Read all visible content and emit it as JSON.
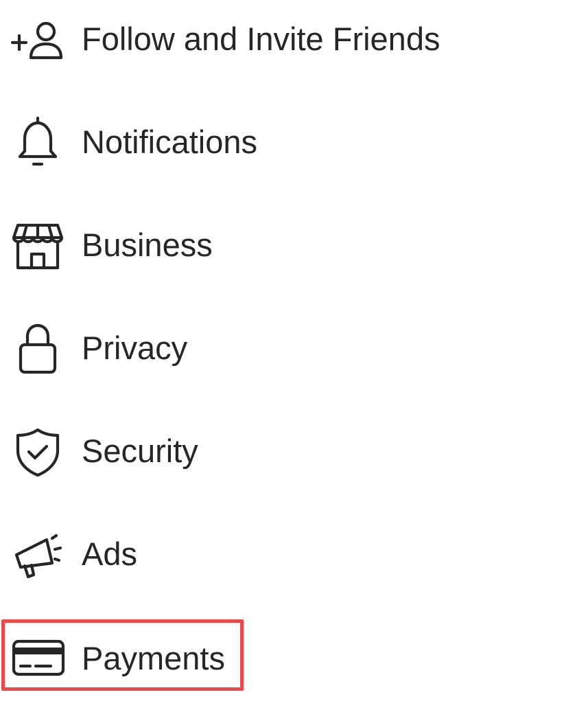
{
  "menu": {
    "items": [
      {
        "label": "Follow and Invite Friends",
        "icon": "add-friend-icon"
      },
      {
        "label": "Notifications",
        "icon": "bell-icon"
      },
      {
        "label": "Business",
        "icon": "storefront-icon"
      },
      {
        "label": "Privacy",
        "icon": "lock-icon"
      },
      {
        "label": "Security",
        "icon": "shield-check-icon"
      },
      {
        "label": "Ads",
        "icon": "megaphone-icon"
      },
      {
        "label": "Payments",
        "icon": "credit-card-icon"
      }
    ],
    "highlighted_item": "Payments"
  },
  "colors": {
    "text": "#262626",
    "icon_stroke": "#262626",
    "highlight_border": "#ea4a4a",
    "background": "#ffffff"
  }
}
